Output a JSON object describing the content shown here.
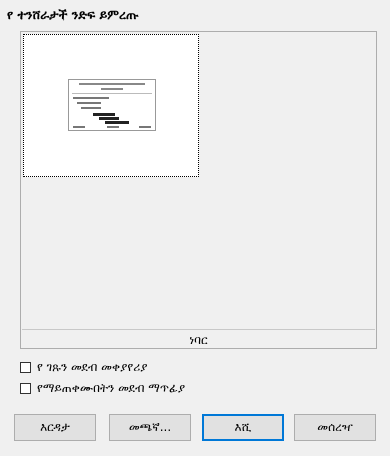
{
  "dialog": {
    "title": "የ ተንሸራታች ንድፍ ይምረጡ"
  },
  "preview": {
    "caption": "ነባር"
  },
  "options": [
    {
      "label": "የ ገጹን መደብ መቀያየሪያ",
      "checked": false
    },
    {
      "label": "የማይጠቀሙበትን መደብ ማጥፊያ",
      "checked": false
    }
  ],
  "buttons": {
    "help": "እርዳታ",
    "browse": "መጫኛ...",
    "ok": "እሺ",
    "cancel": "መሰረዣ"
  }
}
